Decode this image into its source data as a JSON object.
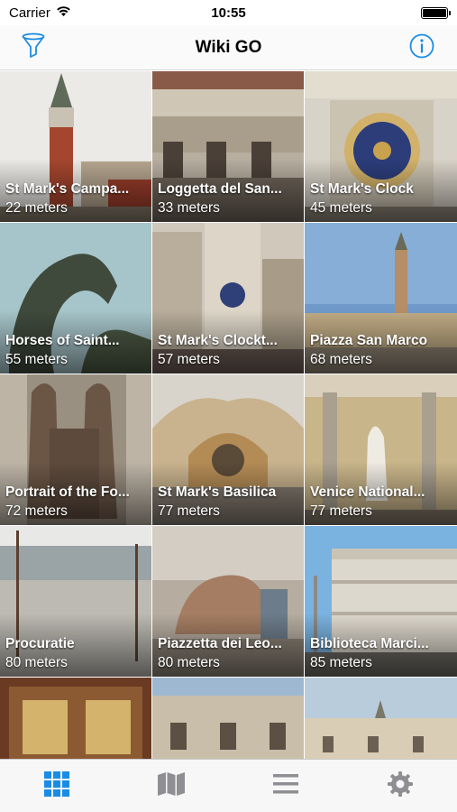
{
  "status": {
    "carrier": "Carrier",
    "time": "10:55"
  },
  "nav": {
    "title": "Wiki GO"
  },
  "colors": {
    "accent": "#1a8ce6",
    "tab_inactive": "#8e8e93"
  },
  "icons": {
    "left": "filter-icon",
    "right": "info-icon"
  },
  "places": [
    {
      "name": "St Mark's Campa...",
      "distance": "22 meters"
    },
    {
      "name": "Loggetta del San...",
      "distance": "33 meters"
    },
    {
      "name": "St Mark's Clock",
      "distance": "45 meters"
    },
    {
      "name": "Horses of Saint...",
      "distance": "55 meters"
    },
    {
      "name": "St Mark's Clockt...",
      "distance": "57 meters"
    },
    {
      "name": "Piazza San Marco",
      "distance": "68 meters"
    },
    {
      "name": "Portrait of the Fo...",
      "distance": "72 meters"
    },
    {
      "name": "St Mark's Basilica",
      "distance": "77 meters"
    },
    {
      "name": "Venice National...",
      "distance": "77 meters"
    },
    {
      "name": "Procuratie",
      "distance": "80 meters"
    },
    {
      "name": "Piazzetta dei Leo...",
      "distance": "80 meters"
    },
    {
      "name": "Biblioteca Marci...",
      "distance": "85 meters"
    },
    {
      "name": "",
      "distance": ""
    },
    {
      "name": "",
      "distance": ""
    },
    {
      "name": "",
      "distance": ""
    }
  ],
  "tabs": [
    {
      "icon": "grid-icon",
      "selected": true
    },
    {
      "icon": "map-icon",
      "selected": false
    },
    {
      "icon": "list-icon",
      "selected": false
    },
    {
      "icon": "settings-icon",
      "selected": false
    }
  ]
}
